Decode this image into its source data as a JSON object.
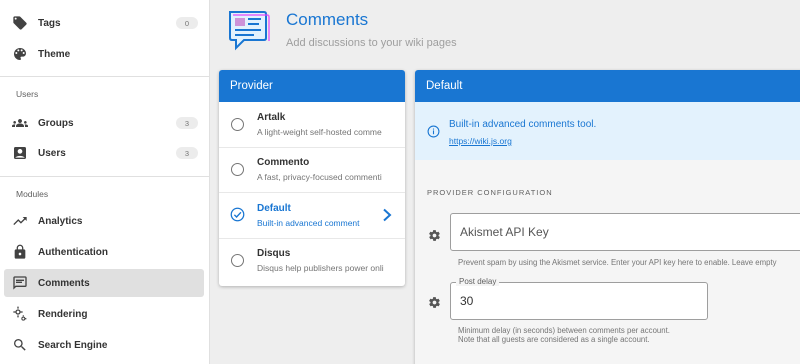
{
  "sidebar": {
    "items_top": [
      {
        "label": "Tags",
        "icon": "tags-icon",
        "badge": "0"
      },
      {
        "label": "Theme",
        "icon": "palette-icon"
      }
    ],
    "users_section": "Users",
    "users_items": [
      {
        "label": "Groups",
        "icon": "groups-icon",
        "badge": "3"
      },
      {
        "label": "Users",
        "icon": "user-card-icon",
        "badge": "3"
      }
    ],
    "modules_section": "Modules",
    "modules_items": [
      {
        "label": "Analytics",
        "icon": "analytics-icon"
      },
      {
        "label": "Authentication",
        "icon": "lock-icon"
      },
      {
        "label": "Comments",
        "icon": "comment-icon",
        "active": true
      },
      {
        "label": "Rendering",
        "icon": "cogs-icon"
      },
      {
        "label": "Search Engine",
        "icon": "search-icon"
      }
    ]
  },
  "header": {
    "title": "Comments",
    "subtitle": "Add discussions to your wiki pages",
    "icon": "comments-header-icon"
  },
  "provider_card": {
    "title": "Provider",
    "providers": [
      {
        "name": "Artalk",
        "desc": "A light-weight self-hosted comme",
        "selected": false
      },
      {
        "name": "Commento",
        "desc": "A fast, privacy-focused commenti",
        "selected": false
      },
      {
        "name": "Default",
        "desc": "Built-in advanced comment",
        "selected": true
      },
      {
        "name": "Disqus",
        "desc": "Disqus help publishers power onli",
        "selected": false
      }
    ]
  },
  "default_card": {
    "title": "Default",
    "info_text": "Built-in advanced comments tool.",
    "info_link": "https://wiki.js.org",
    "section_label": "PROVIDER CONFIGURATION",
    "akismet": {
      "placeholder": "Akismet API Key",
      "hint": "Prevent spam by using the Akismet service. Enter your API key here to enable. Leave empty"
    },
    "post_delay": {
      "label": "Post delay",
      "value": "30",
      "hint_line1": "Minimum delay (in seconds) between comments per account.",
      "hint_line2": "Note that all guests are considered as a single account."
    }
  },
  "colors": {
    "accent": "#1976d2",
    "info_bg": "#e3f2fd",
    "active_nav": "#e0e0e0"
  }
}
